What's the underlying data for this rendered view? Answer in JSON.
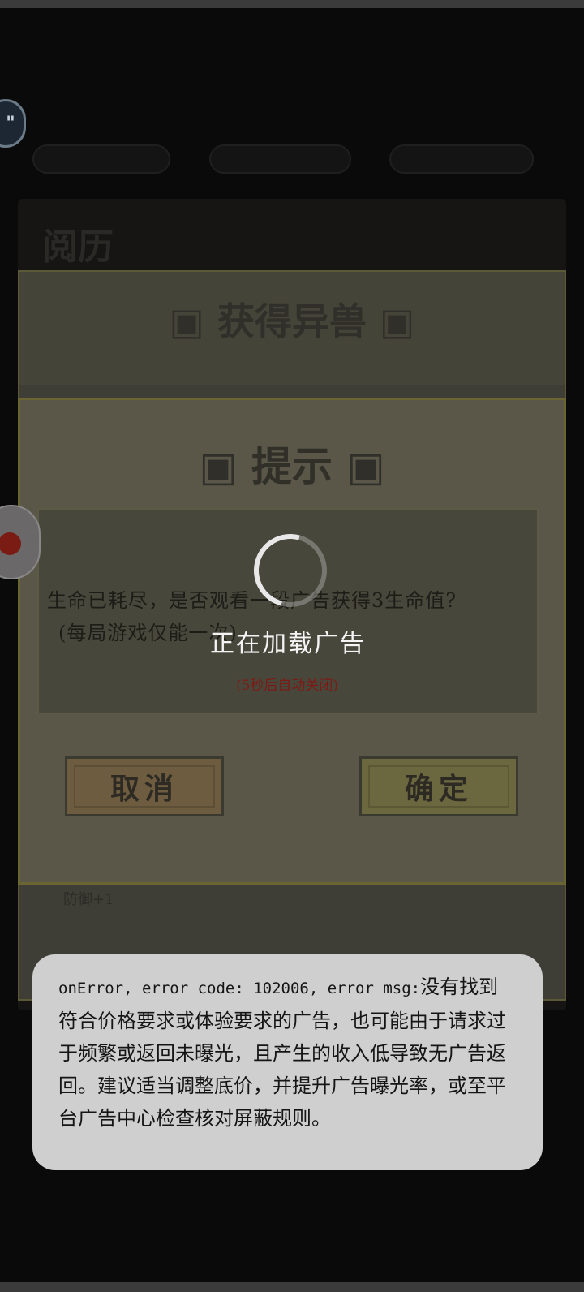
{
  "background": {
    "float_ball_top_glyph": "\"",
    "top_pills": [
      "",
      "",
      ""
    ],
    "panel_title": "阅历",
    "panel_sub": "",
    "panel_large_title": "获得异兽",
    "defense_text": "防御+1"
  },
  "hint_dialog": {
    "title": "提示",
    "message_line1": "生命已耗尽，是否观看一段广告获得3生命值?",
    "message_line2": "(每局游戏仅能一次)",
    "cancel_label": "取消",
    "confirm_label": "确定",
    "title_deco_left": "回",
    "title_deco_right": "回"
  },
  "loading": {
    "text": "正在加载广告",
    "auto_close": "(5秒后自动关闭)"
  },
  "toast": {
    "prefix": "onError, error code: 102006, error msg:",
    "message": "没有找到符合价格要求或体验要求的广告，也可能由于请求过于频繁或返回未曝光，且产生的收入低导致无广告返回。建议适当调整底价，并提升广告曝光率，或至平台广告中心检查核对屏蔽规则。"
  },
  "colors": {
    "cancel_button": "#6e5c40",
    "confirm_button": "#6b6840",
    "toast_bg": "#cfcfcf",
    "auto_close_text": "#7e1a14"
  },
  "icons": [
    "loading-spinner-icon",
    "float-ball-icon",
    "title-deco-icon"
  ]
}
